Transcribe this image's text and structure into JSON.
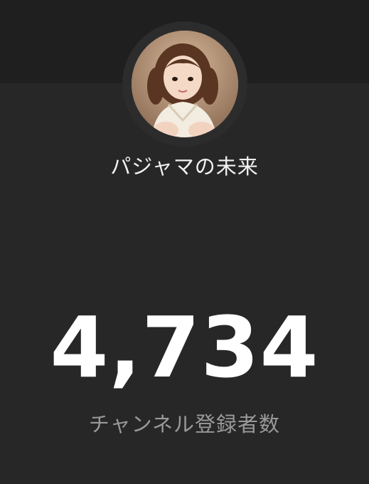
{
  "profile": {
    "avatar_icon": "channel-avatar-photo",
    "channel_name": "パジャマの未来"
  },
  "stats": {
    "subscriber_count": "4,734",
    "subscriber_label": "チャンネル登録者数"
  },
  "colors": {
    "background": "#272727",
    "top_band": "#1f1f1f",
    "count_text": "#ffffff",
    "label_text": "#9a9a9a"
  }
}
